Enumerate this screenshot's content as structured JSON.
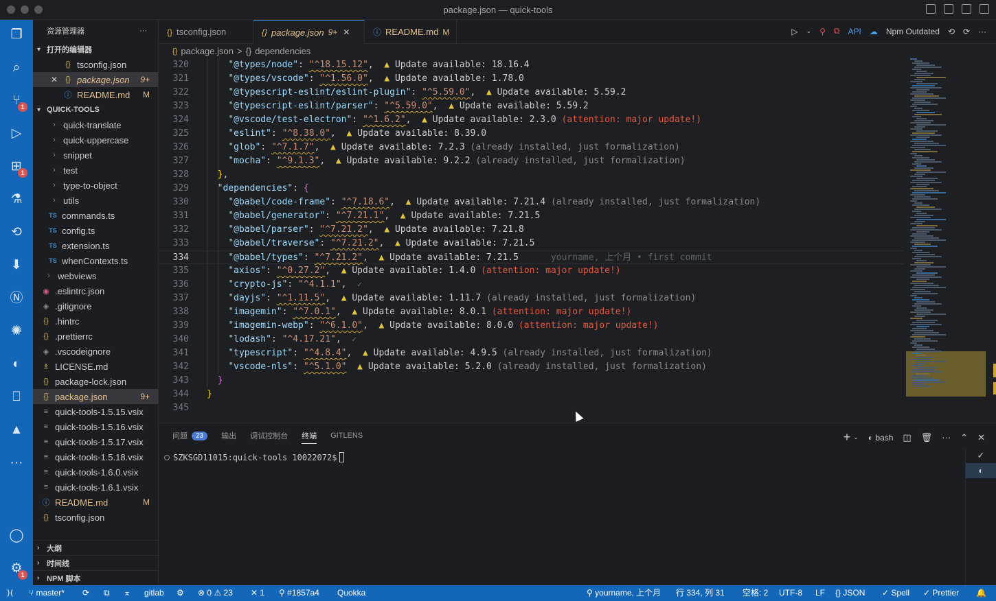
{
  "window": {
    "title": "package.json — quick-tools"
  },
  "activity": {
    "scm_badge": "1",
    "ext_badge": "1",
    "settings_badge": "1"
  },
  "sidebar": {
    "title": "资源管理器",
    "more": "···",
    "open_editors_label": "打开的编辑器",
    "open_editors": [
      {
        "name": "tsconfig.json",
        "icon": "{}",
        "status": ""
      },
      {
        "name": "package.json",
        "icon": "{}",
        "status": "9+",
        "close": "✕"
      },
      {
        "name": "README.md",
        "icon": "ⓘ",
        "status": "M"
      }
    ],
    "project_label": "QUICK-TOOLS",
    "tree": [
      {
        "name": "quick-translate",
        "icon": "›"
      },
      {
        "name": "quick-uppercase",
        "icon": "›"
      },
      {
        "name": "snippet",
        "icon": "›"
      },
      {
        "name": "test",
        "icon": "›"
      },
      {
        "name": "type-to-object",
        "icon": "›"
      },
      {
        "name": "utils",
        "icon": "›"
      },
      {
        "name": "commands.ts",
        "icon": "TS"
      },
      {
        "name": "config.ts",
        "icon": "TS"
      },
      {
        "name": "extension.ts",
        "icon": "TS"
      },
      {
        "name": "whenContexts.ts",
        "icon": "TS"
      },
      {
        "name": "webviews",
        "icon": "›"
      },
      {
        "name": ".eslintrc.json",
        "icon": "◉"
      },
      {
        "name": ".gitignore",
        "icon": "◈"
      },
      {
        "name": ".hintrc",
        "icon": "{}"
      },
      {
        "name": ".prettierrc",
        "icon": "{}"
      },
      {
        "name": ".vscodeignore",
        "icon": "◈"
      },
      {
        "name": "LICENSE.md",
        "icon": "♗"
      },
      {
        "name": "package-lock.json",
        "icon": "{}"
      },
      {
        "name": "package.json",
        "icon": "{}",
        "status": "9+"
      },
      {
        "name": "quick-tools-1.5.15.vsix",
        "icon": "≡"
      },
      {
        "name": "quick-tools-1.5.16.vsix",
        "icon": "≡"
      },
      {
        "name": "quick-tools-1.5.17.vsix",
        "icon": "≡"
      },
      {
        "name": "quick-tools-1.5.18.vsix",
        "icon": "≡"
      },
      {
        "name": "quick-tools-1.6.0.vsix",
        "icon": "≡"
      },
      {
        "name": "quick-tools-1.6.1.vsix",
        "icon": "≡"
      },
      {
        "name": "README.md",
        "icon": "ⓘ",
        "status": "M"
      },
      {
        "name": "tsconfig.json",
        "icon": "{}"
      }
    ],
    "outline_label": "大纲",
    "timeline_label": "时间线",
    "npm_label": "NPM 脚本"
  },
  "tabs": [
    {
      "label": "tsconfig.json",
      "icon": "{}",
      "status": ""
    },
    {
      "label": "package.json",
      "icon": "{}",
      "status": "9+",
      "close": "✕"
    },
    {
      "label": "README.md",
      "icon": "ⓘ",
      "status": "M"
    }
  ],
  "editor_actions": {
    "npm_outdated": "Npm Outdated",
    "api": "API"
  },
  "breadcrumb": {
    "file": "package.json",
    "sep": ">",
    "symbol_icon": "{}",
    "symbol": "dependencies"
  },
  "code_lines": [
    {
      "ln": "320",
      "key": "\"@types/node\"",
      "val": "\"^18.15.12\"",
      "update": "18.16.4"
    },
    {
      "ln": "321",
      "key": "\"@types/vscode\"",
      "val": "\"^1.56.0\"",
      "update": "1.78.0"
    },
    {
      "ln": "322",
      "key": "\"@typescript-eslint/eslint-plugin\"",
      "val": "\"^5.59.0\"",
      "update": "5.59.2"
    },
    {
      "ln": "323",
      "key": "\"@typescript-eslint/parser\"",
      "val": "\"^5.59.0\"",
      "update": "5.59.2"
    },
    {
      "ln": "324",
      "key": "\"@vscode/test-electron\"",
      "val": "\"^1.6.2\"",
      "update": "2.3.0",
      "note": "(attention: major update!)",
      "note_type": "major"
    },
    {
      "ln": "325",
      "key": "\"eslint\"",
      "val": "\"^8.38.0\"",
      "update": "8.39.0"
    },
    {
      "ln": "326",
      "key": "\"glob\"",
      "val": "\"^7.1.7\"",
      "update": "7.2.3",
      "note": "(already installed, just formalization)",
      "note_type": "muted"
    },
    {
      "ln": "327",
      "key": "\"mocha\"",
      "val": "\"^9.1.3\"",
      "update": "9.2.2",
      "note": "(already installed, just formalization)",
      "note_type": "muted"
    },
    {
      "ln": "328",
      "raw": "},",
      "indent": 1
    },
    {
      "ln": "329",
      "key": "\"dependencies\"",
      "raw_after": ": {",
      "indent": 1
    },
    {
      "ln": "330",
      "key": "\"@babel/code-frame\"",
      "val": "\"^7.18.6\"",
      "update": "7.21.4",
      "note": "(already installed, just formalization)",
      "note_type": "muted"
    },
    {
      "ln": "331",
      "key": "\"@babel/generator\"",
      "val": "\"^7.21.1\"",
      "update": "7.21.5"
    },
    {
      "ln": "332",
      "key": "\"@babel/parser\"",
      "val": "\"^7.21.2\"",
      "update": "7.21.8"
    },
    {
      "ln": "333",
      "key": "\"@babel/traverse\"",
      "val": "\"^7.21.2\"",
      "update": "7.21.5"
    },
    {
      "ln": "334",
      "key": "\"@babel/types\"",
      "val": "\"^7.21.2\"",
      "update": "7.21.5",
      "blame": "yourname, 上个月 • first commit",
      "current": true
    },
    {
      "ln": "335",
      "key": "\"axios\"",
      "val": "\"^0.27.2\"",
      "update": "1.4.0",
      "note": "(attention: major update!)",
      "note_type": "major"
    },
    {
      "ln": "336",
      "key": "\"crypto-js\"",
      "val": "\"^4.1.1\"",
      "ok": "✓"
    },
    {
      "ln": "337",
      "key": "\"dayjs\"",
      "val": "\"^1.11.5\"",
      "update": "1.11.7",
      "note": "(already installed, just formalization)",
      "note_type": "muted"
    },
    {
      "ln": "338",
      "key": "\"imagemin\"",
      "val": "\"^7.0.1\"",
      "update": "8.0.1",
      "note": "(attention: major update!)",
      "note_type": "major"
    },
    {
      "ln": "339",
      "key": "\"imagemin-webp\"",
      "val": "\"^6.1.0\"",
      "update": "8.0.0",
      "note": "(attention: major update!)",
      "note_type": "major"
    },
    {
      "ln": "340",
      "key": "\"lodash\"",
      "val": "\"^4.17.21\"",
      "ok": "✓"
    },
    {
      "ln": "341",
      "key": "\"typescript\"",
      "val": "\"^4.8.4\"",
      "update": "4.9.5",
      "note": "(already installed, just formalization)",
      "note_type": "muted"
    },
    {
      "ln": "342",
      "key": "\"vscode-nls\"",
      "val": "\"^5.1.0\"",
      "update": "5.2.0",
      "note": "(already installed, just formalization)",
      "note_type": "muted",
      "nocomma": true
    },
    {
      "ln": "343",
      "raw": "}",
      "indent": 1
    },
    {
      "ln": "344",
      "raw": "}",
      "indent": 0
    },
    {
      "ln": "345",
      "raw": "",
      "indent": 0
    }
  ],
  "update_label": "Update available:",
  "panel": {
    "tabs": [
      "问题",
      "输出",
      "调试控制台",
      "终端",
      "GITLENS"
    ],
    "problems_count": "23",
    "shell": "bash",
    "prompt": "SZKSGD11015:quick-tools 10022072$"
  },
  "status": {
    "branch": "master*",
    "gitlab": "gitlab",
    "errors": "0",
    "warnings": "23",
    "ports": "1",
    "commit": "#1857a4",
    "quokka": "Quokka",
    "blame": "yourname, 上个月",
    "position": "行 334, 列 31",
    "spaces": "空格: 2",
    "encoding": "UTF-8",
    "eol": "LF",
    "language": "JSON",
    "spell": "Spell",
    "prettier": "Prettier"
  },
  "colors": {
    "accent": "#1466b8",
    "warning": "#e2c541",
    "major": "#e5573e",
    "modified": "#e2c08d"
  }
}
